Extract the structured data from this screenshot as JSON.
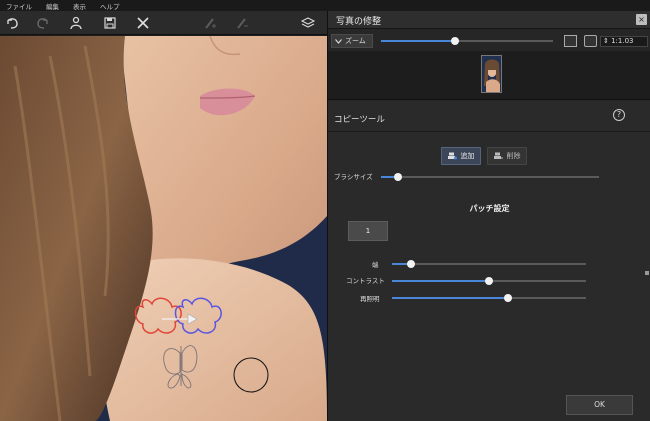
{
  "menu": [
    "ファイル",
    "編集",
    "表示",
    "ヘルプ"
  ],
  "toolbar": {
    "icons": [
      "undo-icon",
      "redo-icon",
      "person-icon",
      "save-icon",
      "close-icon",
      "brush-plus-icon",
      "brush-minus-icon",
      "layers-icon"
    ]
  },
  "panel": {
    "title": "写真の修整",
    "close_label": "×"
  },
  "zoom": {
    "label": "ズーム",
    "level_fraction": 0.43,
    "value": "1:1.03"
  },
  "tool": {
    "title": "コピーツール",
    "help_label": "?",
    "add_label": "追加",
    "remove_label": "削除",
    "brush_size_label": "ブラシサイズ",
    "brush_size_level": 0.08,
    "patch_title": "パッチ設定",
    "patch_value": "1",
    "edge_label": "端",
    "edge_level": 0.1,
    "contrast_label": "コントラスト",
    "contrast_level": 0.5,
    "brightness_label": "再照明",
    "brightness_level": 0.6,
    "ok_label": "OK"
  },
  "colors": {
    "accent": "#4a86d8",
    "source_outline": "#e0473a",
    "target_outline": "#5a56e0"
  }
}
